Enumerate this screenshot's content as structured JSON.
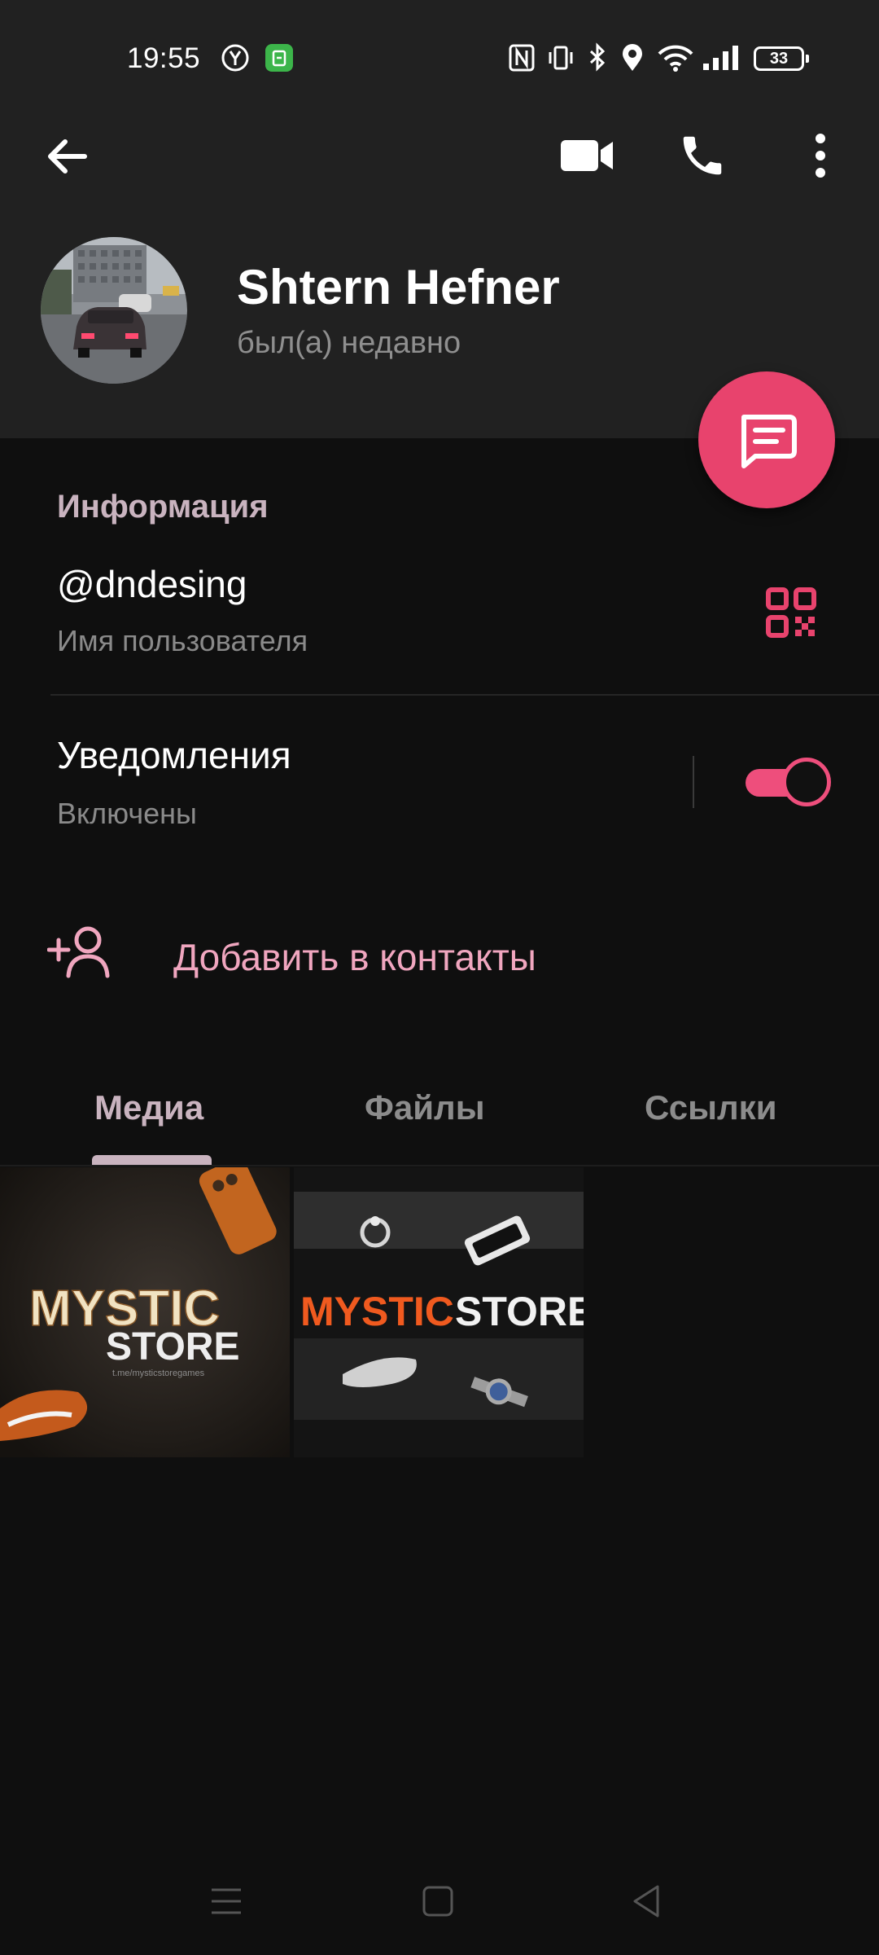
{
  "status_bar": {
    "time": "19:55",
    "battery": "33"
  },
  "toolbar": {
    "back_icon": "arrow-left-icon",
    "video_icon": "video-camera-icon",
    "call_icon": "phone-icon",
    "more_icon": "more-vertical-icon"
  },
  "profile": {
    "name": "Shtern Hefner",
    "status": "был(а) недавно"
  },
  "fab": {
    "icon": "message-icon",
    "color": "#e8436d"
  },
  "info": {
    "section_title": "Информация",
    "username": "@dndesing",
    "username_label": "Имя пользователя",
    "notifications_title": "Уведомления",
    "notifications_status": "Включены",
    "notifications_enabled": true
  },
  "actions": {
    "add_contact": "Добавить в контакты"
  },
  "tabs": [
    {
      "label": "Медиа",
      "active": true
    },
    {
      "label": "Файлы",
      "active": false
    },
    {
      "label": "Ссылки",
      "active": false
    }
  ],
  "media": [
    {
      "line1": "MYSTIC",
      "line2": "STORE",
      "caption": "t.me/mysticstoregames"
    },
    {
      "word1": "MYSTIC",
      "word2": "STORE"
    }
  ],
  "colors": {
    "accent": "#e8436d",
    "accent_light": "#f0a6bf",
    "header_bg": "#212121",
    "body_bg": "#0f0f0f"
  }
}
